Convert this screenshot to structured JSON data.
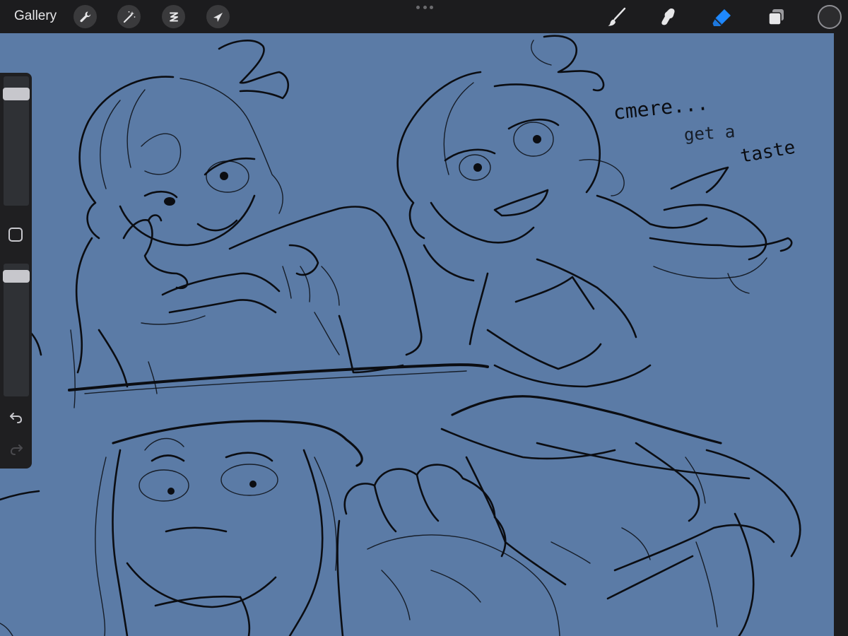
{
  "topbar": {
    "gallery_label": "Gallery",
    "left_tools": [
      {
        "name": "actions",
        "icon": "wrench-icon"
      },
      {
        "name": "adjustments",
        "icon": "magic-wand-icon"
      },
      {
        "name": "selection",
        "icon": "selection-s-icon"
      },
      {
        "name": "transform",
        "icon": "arrow-cursor-icon"
      }
    ],
    "right_tools": [
      {
        "name": "brush",
        "icon": "brush-icon",
        "active": false
      },
      {
        "name": "smudge",
        "icon": "smudge-finger-icon",
        "active": false
      },
      {
        "name": "eraser",
        "icon": "eraser-icon",
        "active": true
      },
      {
        "name": "layers",
        "icon": "layers-icon",
        "active": false
      }
    ],
    "current_color": "#2c2c2e",
    "active_tool_color": "#1e88ff"
  },
  "sidebar": {
    "brush_size_level": 0.9,
    "opacity_level": 0.95,
    "icons": [
      "modify-square-icon",
      "undo-icon",
      "redo-icon"
    ]
  },
  "canvas": {
    "background_color": "#5b7ba6",
    "ink_color": "#0b0d12",
    "handwritten_text": {
      "line1": "cmere...",
      "line2": "get a",
      "line3": "taste"
    }
  }
}
